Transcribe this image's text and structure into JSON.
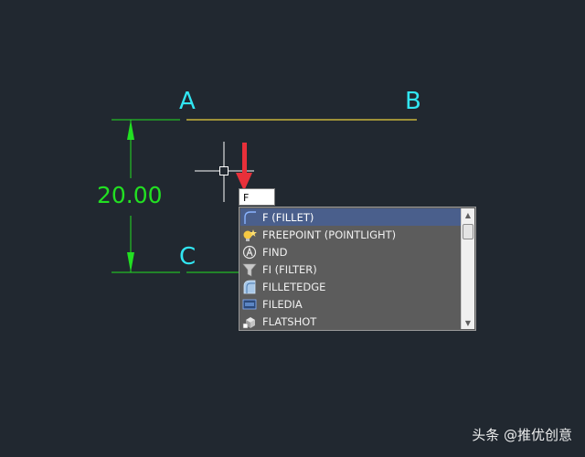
{
  "drawing": {
    "labels": {
      "a": "A",
      "b": "B",
      "c": "C"
    },
    "dimension_text": "20.00",
    "colors": {
      "background": "#212830",
      "dimension": "#22e022",
      "labels": "#31e6f2",
      "line_ab": "#c8b43a",
      "arrow": "#e8303a",
      "crosshair": "#ffffff"
    }
  },
  "command_input": {
    "value": "F"
  },
  "autocomplete": {
    "items": [
      {
        "label": "F (FILLET)",
        "icon": "fillet-icon",
        "selected": true
      },
      {
        "label": "FREEPOINT (POINTLIGHT)",
        "icon": "point-light-icon",
        "selected": false
      },
      {
        "label": "FIND",
        "icon": "find-icon",
        "selected": false
      },
      {
        "label": "FI (FILTER)",
        "icon": "filter-funnel-icon",
        "selected": false
      },
      {
        "label": "FILLETEDGE",
        "icon": "fillet-edge-icon",
        "selected": false
      },
      {
        "label": "FILEDIA",
        "icon": "file-dialog-icon",
        "selected": false
      },
      {
        "label": "FLATSHOT",
        "icon": "flatshot-icon",
        "selected": false
      }
    ]
  },
  "watermark": "头条 @推优创意"
}
